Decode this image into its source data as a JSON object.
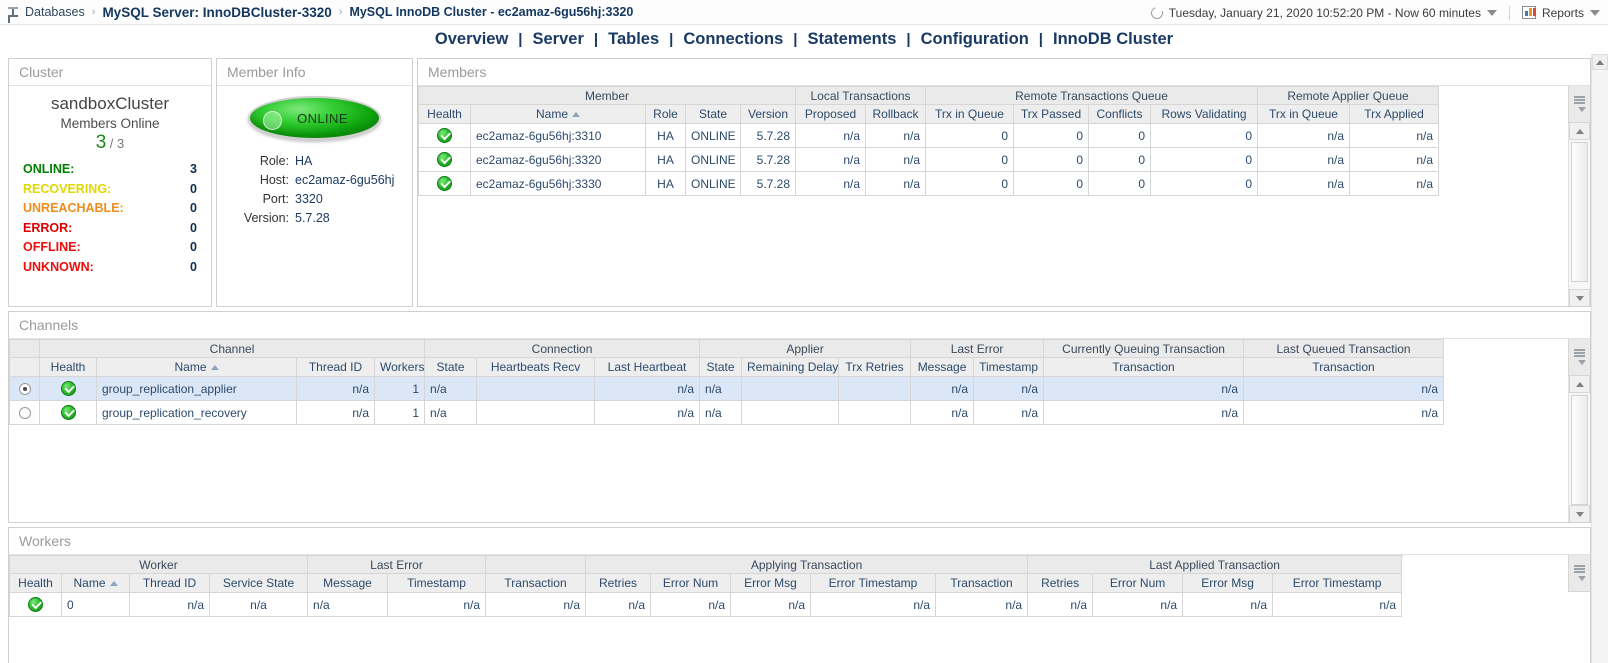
{
  "topbar": {
    "home_icon": "databases-icon",
    "breadcrumb": [
      "Databases",
      "MySQL Server: InnoDBCluster-3320",
      "MySQL InnoDB Cluster - ec2amaz-6gu56hj:3320"
    ],
    "separator": "›",
    "time_icon": "refresh-time-icon",
    "time_range": "Tuesday, January 21, 2020 10:52:20 PM - Now 60 minutes",
    "reports_icon": "reports-chart-icon",
    "reports_label": "Reports"
  },
  "nav": {
    "items": [
      "Overview",
      "Server",
      "Tables",
      "Connections",
      "Statements",
      "Configuration",
      "InnoDB Cluster"
    ],
    "separator": "|",
    "active": "InnoDB Cluster"
  },
  "cluster": {
    "title": "Cluster",
    "name": "sandboxCluster",
    "subtitle": "Members Online",
    "online_count": "3",
    "total_count": "/ 3",
    "stats": [
      {
        "label": "ONLINE:",
        "value": "3",
        "color": "#008000"
      },
      {
        "label": "RECOVERING:",
        "value": "0",
        "color": "#e0d800"
      },
      {
        "label": "UNREACHABLE:",
        "value": "0",
        "color": "#ef8c1c"
      },
      {
        "label": "ERROR:",
        "value": "0",
        "color": "#e00000"
      },
      {
        "label": "OFFLINE:",
        "value": "0",
        "color": "#f20d0d"
      },
      {
        "label": "UNKNOWN:",
        "value": "0",
        "color": "#f20d0d"
      }
    ]
  },
  "member_info": {
    "title": "Member Info",
    "status_badge": "ONLINE",
    "fields": [
      {
        "label": "Role:",
        "value": "HA"
      },
      {
        "label": "Host:",
        "value": "ec2amaz-6gu56hj"
      },
      {
        "label": "Port:",
        "value": "3320"
      },
      {
        "label": "Version:",
        "value": "5.7.28"
      }
    ]
  },
  "members": {
    "title": "Members",
    "groups": [
      {
        "label": "Member",
        "span": 5
      },
      {
        "label": "Local Transactions",
        "span": 2
      },
      {
        "label": "Remote Transactions Queue",
        "span": 4
      },
      {
        "label": "Remote Applier Queue",
        "span": 2
      }
    ],
    "columns": [
      "Health",
      "Name",
      "Role",
      "State",
      "Version",
      "Proposed",
      "Rollback",
      "Trx in Queue",
      "Trx Passed",
      "Conflicts",
      "Rows Validating",
      "Trx in Queue",
      "Trx Applied"
    ],
    "sorted_column": "Name",
    "rows": [
      {
        "health": "ok",
        "name": "ec2amaz-6gu56hj:3310",
        "role": "HA",
        "state": "ONLINE",
        "version": "5.7.28",
        "proposed": "n/a",
        "rollback": "n/a",
        "rq_trx_in_queue": "0",
        "rq_trx_passed": "0",
        "rq_conflicts": "0",
        "rq_rows_validating": "0",
        "ra_trx_in_queue": "n/a",
        "ra_trx_applied": "n/a"
      },
      {
        "health": "ok",
        "name": "ec2amaz-6gu56hj:3320",
        "role": "HA",
        "state": "ONLINE",
        "version": "5.7.28",
        "proposed": "n/a",
        "rollback": "n/a",
        "rq_trx_in_queue": "0",
        "rq_trx_passed": "0",
        "rq_conflicts": "0",
        "rq_rows_validating": "0",
        "ra_trx_in_queue": "n/a",
        "ra_trx_applied": "n/a"
      },
      {
        "health": "ok",
        "name": "ec2amaz-6gu56hj:3330",
        "role": "HA",
        "state": "ONLINE",
        "version": "5.7.28",
        "proposed": "n/a",
        "rollback": "n/a",
        "rq_trx_in_queue": "0",
        "rq_trx_passed": "0",
        "rq_conflicts": "0",
        "rq_rows_validating": "0",
        "ra_trx_in_queue": "n/a",
        "ra_trx_applied": "n/a"
      }
    ]
  },
  "channels": {
    "title": "Channels",
    "groups": [
      {
        "label": "",
        "span": 1
      },
      {
        "label": "Channel",
        "span": 4
      },
      {
        "label": "Connection",
        "span": 3
      },
      {
        "label": "Applier",
        "span": 3
      },
      {
        "label": "Last Error",
        "span": 2
      },
      {
        "label": "Currently Queuing Transaction",
        "span": 1
      },
      {
        "label": "Last Queued Transaction",
        "span": 1
      }
    ],
    "columns": [
      "Health",
      "Name",
      "Thread ID",
      "Workers",
      "State",
      "Heartbeats Recv",
      "Last Heartbeat",
      "State",
      "Remaining Delay",
      "Trx Retries",
      "Message",
      "Timestamp",
      "Transaction",
      "Transaction"
    ],
    "sorted_column": "Name",
    "rows": [
      {
        "selected": true,
        "health": "ok",
        "name": "group_replication_applier",
        "thread_id": "n/a",
        "workers": "1",
        "conn_state": "n/a",
        "heartbeats_recv": "",
        "last_heartbeat": "n/a",
        "app_state": "n/a",
        "remaining_delay": "",
        "trx_retries": "",
        "err_message": "n/a",
        "err_timestamp": "n/a",
        "queuing_trx": "n/a",
        "last_queued_trx": "n/a"
      },
      {
        "selected": false,
        "health": "ok",
        "name": "group_replication_recovery",
        "thread_id": "n/a",
        "workers": "1",
        "conn_state": "n/a",
        "heartbeats_recv": "",
        "last_heartbeat": "n/a",
        "app_state": "n/a",
        "remaining_delay": "",
        "trx_retries": "",
        "err_message": "n/a",
        "err_timestamp": "n/a",
        "queuing_trx": "n/a",
        "last_queued_trx": "n/a"
      }
    ]
  },
  "workers": {
    "title": "Workers",
    "groups": [
      {
        "label": "Worker",
        "span": 4
      },
      {
        "label": "Last Error",
        "span": 2
      },
      {
        "label": "",
        "span": 1
      },
      {
        "label": "Applying Transaction",
        "span": 5
      },
      {
        "label": "Last Applied Transaction",
        "span": 5
      }
    ],
    "columns": [
      "Health",
      "Name",
      "Thread ID",
      "Service State",
      "Message",
      "Timestamp",
      "Transaction",
      "Retries",
      "Error Num",
      "Error Msg",
      "Error Timestamp",
      "Transaction",
      "Retries",
      "Error Num",
      "Error Msg",
      "Error Timestamp"
    ],
    "sorted_column": "Name",
    "rows": [
      {
        "health": "ok",
        "name": "0",
        "thread_id": "n/a",
        "service_state": "n/a",
        "err_message": "n/a",
        "err_timestamp": "n/a",
        "ap_transaction": "n/a",
        "ap_retries": "n/a",
        "ap_error_num": "n/a",
        "ap_error_msg": "n/a",
        "ap_error_timestamp": "n/a",
        "la_transaction": "n/a",
        "la_retries": "n/a",
        "la_error_num": "n/a",
        "la_error_msg": "n/a",
        "la_error_timestamp": "n/a"
      }
    ]
  }
}
